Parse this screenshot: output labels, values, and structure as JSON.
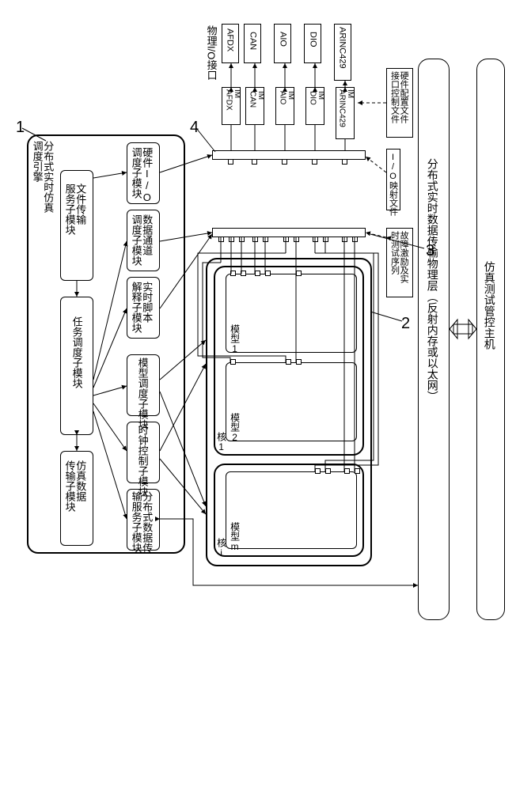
{
  "callouts": {
    "c1": "1",
    "c2": "2",
    "c3": "3",
    "c4": "4"
  },
  "engine_title": "分布式实时仿真\n调度引擎",
  "engine_left": {
    "file_service": "文件传输\n服务子模块",
    "task_sched": "任务调度子模块",
    "sim_data": "仿真数据\n传输子模块"
  },
  "engine_right": {
    "hw_io": "硬件I/O\n调度子模块",
    "data_ch": "数据通道\n调度子模块",
    "rt_script": "实时脚本\n解释子模块",
    "model_sched": "模型调度子模块",
    "clock_ctrl": "时钟控制子模块",
    "dist_data": "分布式数据传\n输服务子模块"
  },
  "phy_io_label": "物理I/O接口",
  "phy_io": [
    "AFDX",
    "CAN",
    "AIO",
    "DIO",
    "ARINC429"
  ],
  "im": [
    "IM\nAFDX",
    "IM\nCAN",
    "IM\nAIO",
    "IM\nDIO",
    "IM\nARINC429"
  ],
  "cfg_files": {
    "hw_cfg": "硬件配置文件\n接口控制文件",
    "io_map": "I/O映射文件",
    "fault": "故障激励及实\n时测试序列"
  },
  "transport": "分布式实时数据传输物理层（反射内存或以太网）",
  "host": "仿真测试管控主机",
  "core_outer": {
    "core1": "核1",
    "corei": "核i"
  },
  "models": {
    "m1": "模型1",
    "m2": "模型2",
    "mm": "模型m"
  }
}
